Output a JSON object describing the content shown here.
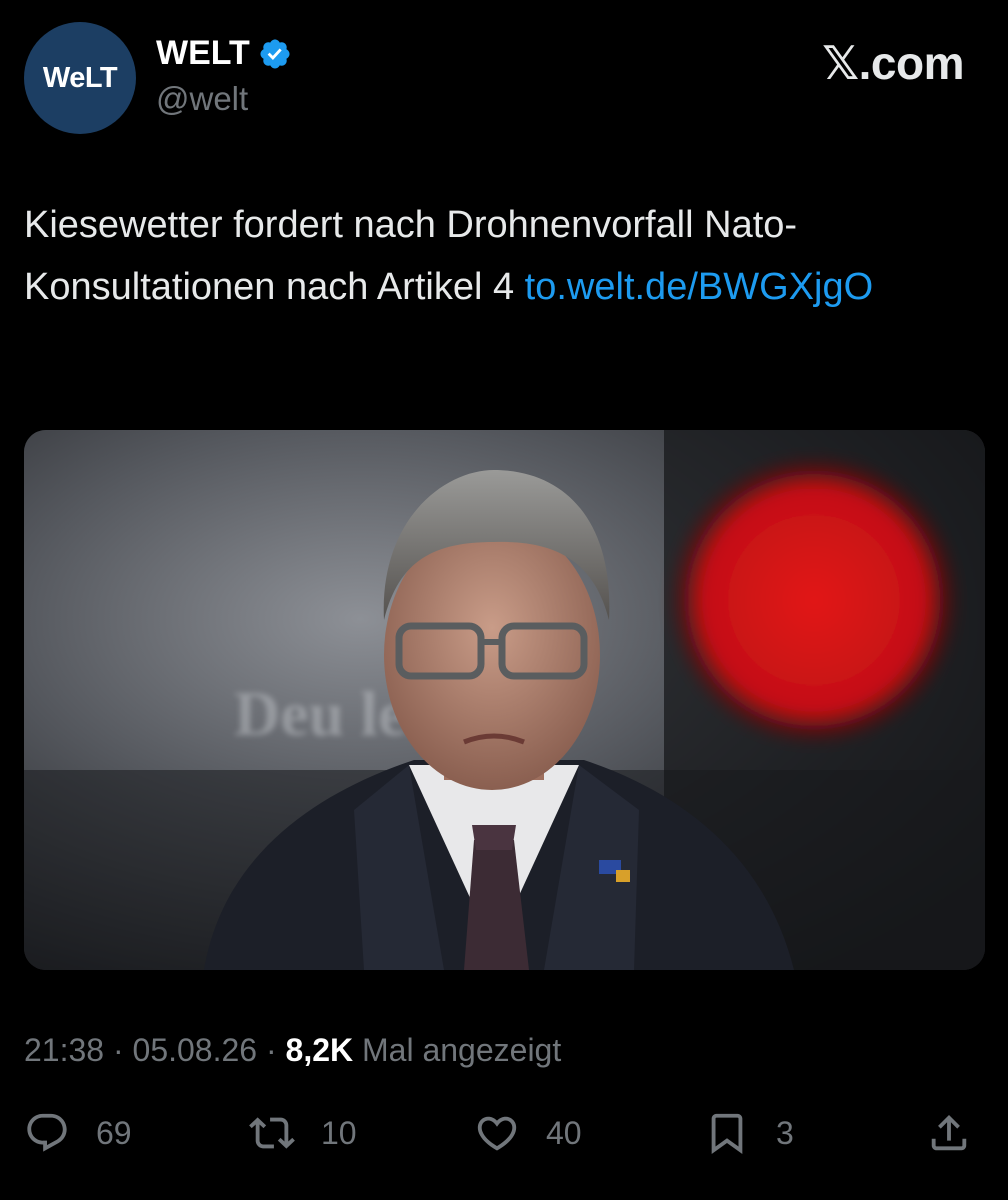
{
  "account": {
    "avatar_text": "WeLT",
    "display_name": "WELT",
    "handle": "@welt",
    "verified_icon": "verified-badge-icon"
  },
  "site_label": "𝕏.com",
  "tweet": {
    "text": "Kiesewetter fordert nach Drohnenvorfall Nato-Konsultationen nach Artikel 4 ",
    "link": "to.welt.de/BWGXjgO"
  },
  "media": {
    "backdrop_text": "Deu      ler  I"
  },
  "meta": {
    "time": "21:38",
    "sep1": " · ",
    "date": "05.08.26",
    "sep2": " · ",
    "views": "8,2K",
    "views_label": " Mal angezeigt"
  },
  "actions": {
    "replies": "69",
    "reposts": "10",
    "likes": "40",
    "bookmarks": "3"
  },
  "colors": {
    "background": "#000000",
    "text": "#e7e9ea",
    "muted": "#71767b",
    "link": "#1d9bf0",
    "avatar_bg": "#1c3e63",
    "verified": "#1d9bf0"
  }
}
